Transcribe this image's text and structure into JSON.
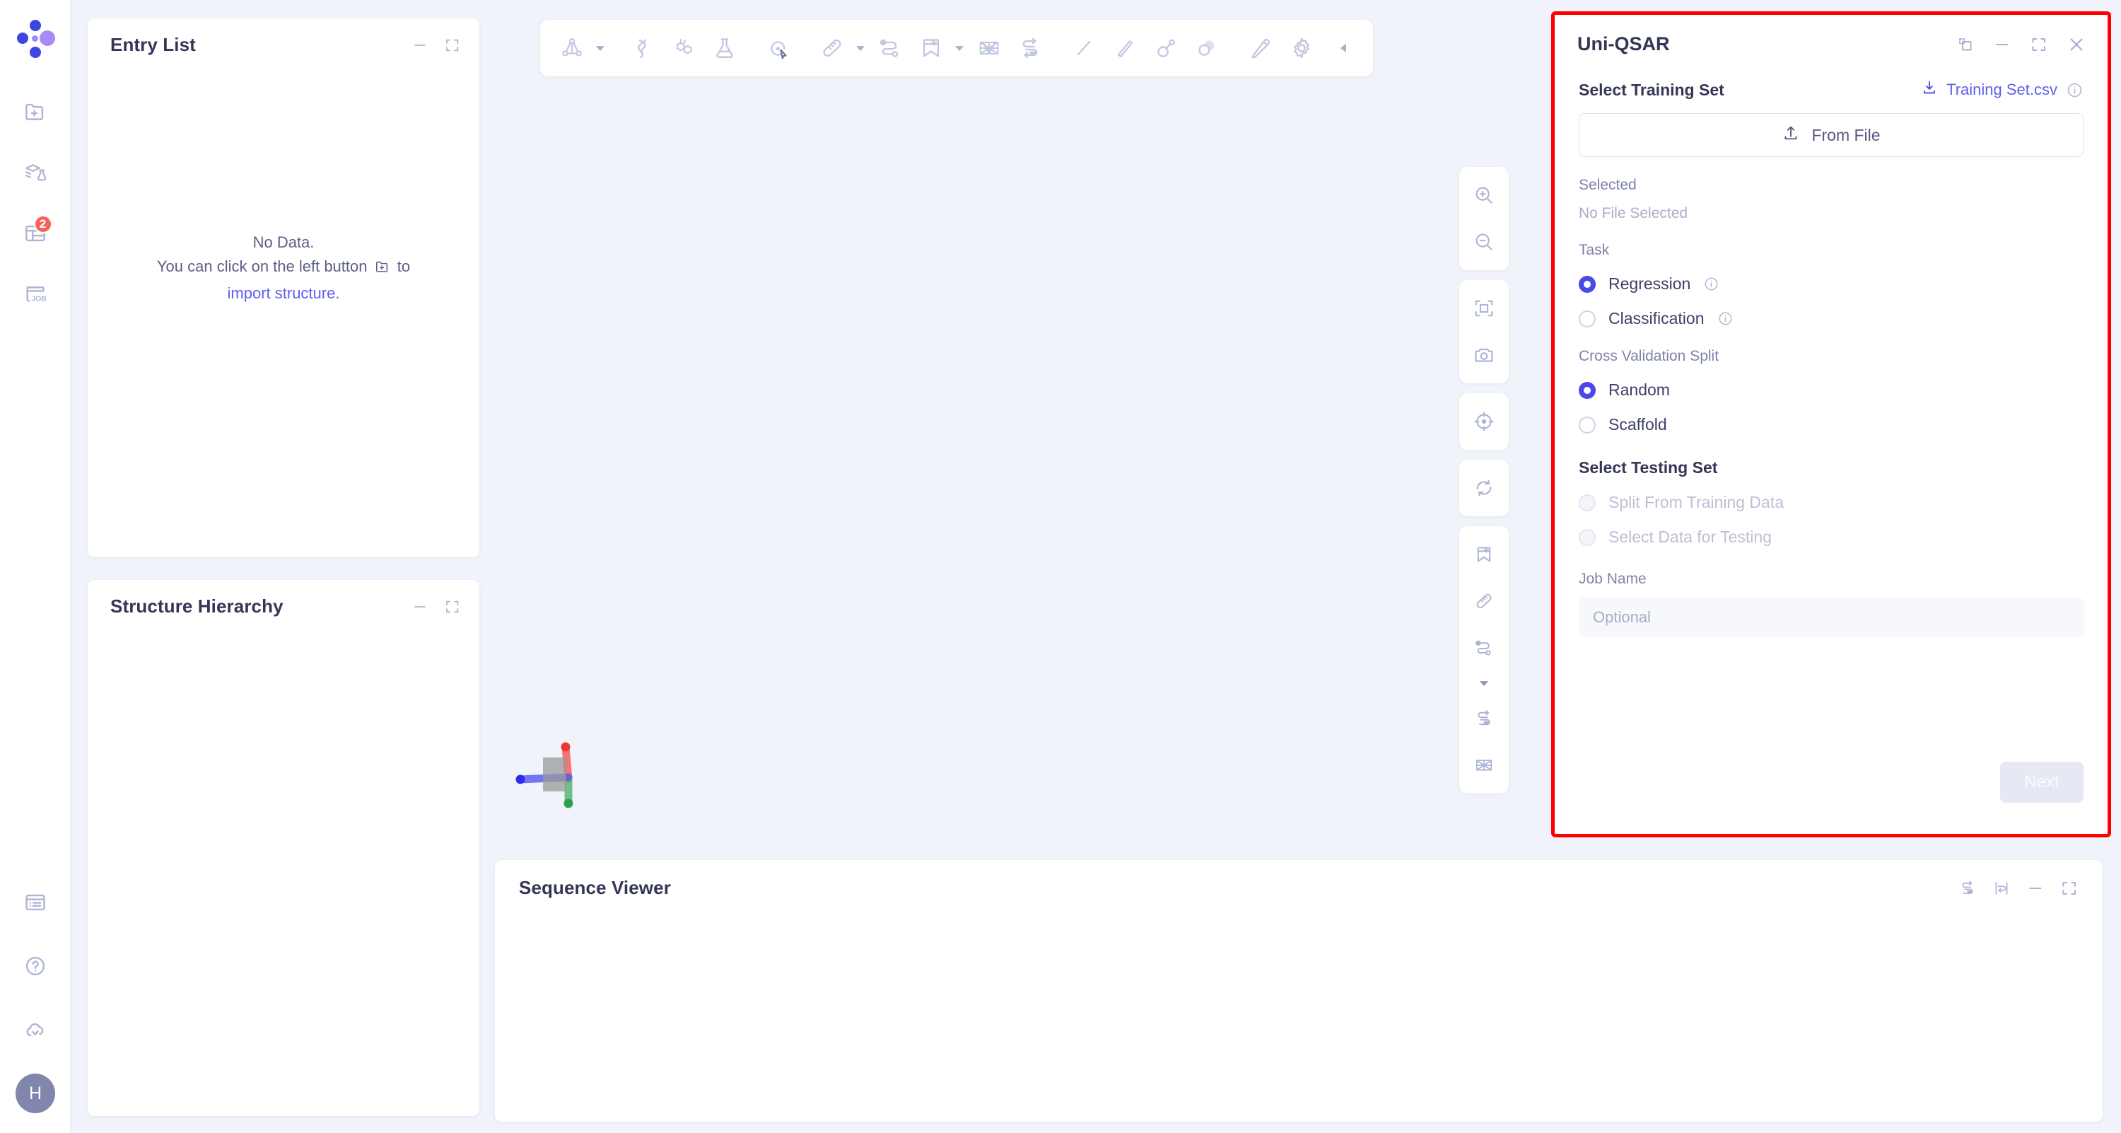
{
  "sidebar": {
    "logo_name": "app-logo",
    "top_items": [
      {
        "name": "import-structure-icon",
        "label": "Import Structure",
        "badge": null
      },
      {
        "name": "library-icon",
        "label": "Library",
        "badge": null
      },
      {
        "name": "table-icon",
        "label": "Data Tables",
        "badge": "2"
      },
      {
        "name": "job-icon",
        "label": "JOB",
        "badge": null
      }
    ],
    "bottom_items": [
      {
        "name": "notes-icon",
        "label": "Notes"
      },
      {
        "name": "help-icon",
        "label": "Help"
      },
      {
        "name": "cloud-sync-icon",
        "label": "Cloud Sync"
      }
    ],
    "avatar_initial": "H"
  },
  "entry_list": {
    "title": "Entry List",
    "empty_line1": "No Data.",
    "empty_line2_a": "You can click on the left button",
    "empty_line2_b": "to",
    "empty_link": "import structure.",
    "minimize_label": "Minimize",
    "expand_label": "Expand"
  },
  "structure_hierarchy": {
    "title": "Structure Hierarchy",
    "minimize_label": "Minimize",
    "expand_label": "Expand"
  },
  "sequence_viewer": {
    "title": "Sequence Viewer",
    "controls": [
      {
        "name": "swap-arrows-icon",
        "label": "Swap"
      },
      {
        "name": "wrap-lines-icon",
        "label": "Wrap"
      },
      {
        "name": "minimize-icon",
        "label": "Minimize"
      },
      {
        "name": "expand-icon",
        "label": "Expand"
      }
    ]
  },
  "toolbar": {
    "items": [
      {
        "name": "molecule-structure-icon",
        "label": "Structure",
        "caret": true
      },
      {
        "name": "dna-helix-icon",
        "label": "Nucleic Acid",
        "caret": false
      },
      {
        "name": "benzene-ring-icon",
        "label": "Small Molecule",
        "caret": false
      },
      {
        "name": "flask-icon",
        "label": "Experiment",
        "caret": false
      },
      {
        "name": "select-cursor-icon",
        "label": "Select",
        "caret": false
      },
      {
        "name": "ruler-icon",
        "label": "Measure",
        "caret": true
      },
      {
        "name": "path-icon",
        "label": "Path",
        "caret": false
      },
      {
        "name": "bookmark-add-icon",
        "label": "Bookmark",
        "caret": true
      },
      {
        "name": "surface-mesh-icon",
        "label": "Surface",
        "caret": false
      },
      {
        "name": "swap-arrows-icon",
        "label": "Swap",
        "caret": false
      },
      {
        "name": "line-icon",
        "label": "Line",
        "caret": false
      },
      {
        "name": "pencil-line-icon",
        "label": "Draw Bond",
        "caret": false
      },
      {
        "name": "bond-node-icon",
        "label": "Bond",
        "caret": false
      },
      {
        "name": "spheres-icon",
        "label": "Spheres",
        "caret": false
      },
      {
        "name": "edit-pencil-icon",
        "label": "Edit",
        "caret": false
      },
      {
        "name": "gear-icon",
        "label": "Settings",
        "caret": false
      }
    ],
    "collapse_name": "collapse-toolbar-arrow-icon",
    "collapse_label": "Collapse"
  },
  "viewport_tools": {
    "groups": [
      {
        "items": [
          {
            "name": "zoom-in-icon",
            "label": "Zoom In"
          },
          {
            "name": "zoom-out-icon",
            "label": "Zoom Out"
          }
        ]
      },
      {
        "items": [
          {
            "name": "fit-to-screen-icon",
            "label": "Fit to Screen"
          },
          {
            "name": "camera-icon",
            "label": "Screenshot"
          }
        ]
      },
      {
        "items": [
          {
            "name": "center-target-icon",
            "label": "Center View"
          }
        ]
      },
      {
        "items": [
          {
            "name": "refresh-icon",
            "label": "Reset View"
          }
        ]
      },
      {
        "items": [
          {
            "name": "bookmark-add-icon",
            "label": "Add Bookmark"
          },
          {
            "name": "ruler-icon",
            "label": "Measure"
          },
          {
            "name": "path-icon",
            "label": "Path"
          },
          {
            "name": "more-caret-icon",
            "label": "More"
          },
          {
            "name": "swap-arrows-icon",
            "label": "Swap"
          },
          {
            "name": "surface-mesh-icon",
            "label": "Surface"
          }
        ]
      }
    ]
  },
  "qsar": {
    "title": "Uni-QSAR",
    "window_controls": [
      {
        "name": "popout-icon",
        "label": "Pop Out"
      },
      {
        "name": "minimize-icon",
        "label": "Minimize"
      },
      {
        "name": "expand-icon",
        "label": "Expand"
      },
      {
        "name": "close-icon",
        "label": "Close"
      }
    ],
    "training_set_title": "Select Training Set",
    "template_file": "Training Set.csv",
    "from_file_label": "From File",
    "selected_label": "Selected",
    "selected_value": "No File Selected",
    "task_label": "Task",
    "task_options": [
      {
        "label": "Regression",
        "selected": true,
        "info": true,
        "disabled": false
      },
      {
        "label": "Classification",
        "selected": false,
        "info": true,
        "disabled": false
      }
    ],
    "cv_label": "Cross Validation Split",
    "cv_options": [
      {
        "label": "Random",
        "selected": true,
        "info": false,
        "disabled": false
      },
      {
        "label": "Scaffold",
        "selected": false,
        "info": false,
        "disabled": false
      }
    ],
    "testing_set_title": "Select Testing Set",
    "testing_options": [
      {
        "label": "Split From Training Data",
        "selected": false,
        "info": false,
        "disabled": true
      },
      {
        "label": "Select Data for Testing",
        "selected": false,
        "info": false,
        "disabled": true
      }
    ],
    "job_name_label": "Job Name",
    "job_name_value": "",
    "job_name_placeholder": "Optional",
    "next_label": "Next"
  },
  "colors": {
    "accent": "#5d5fef",
    "radio_on": "#4a49e8",
    "highlight_border": "#fe0000",
    "badge_red": "#f4645f",
    "icon_muted": "#aeb4d4",
    "title_text": "#343657",
    "app_bg": "#f0f3f9"
  }
}
